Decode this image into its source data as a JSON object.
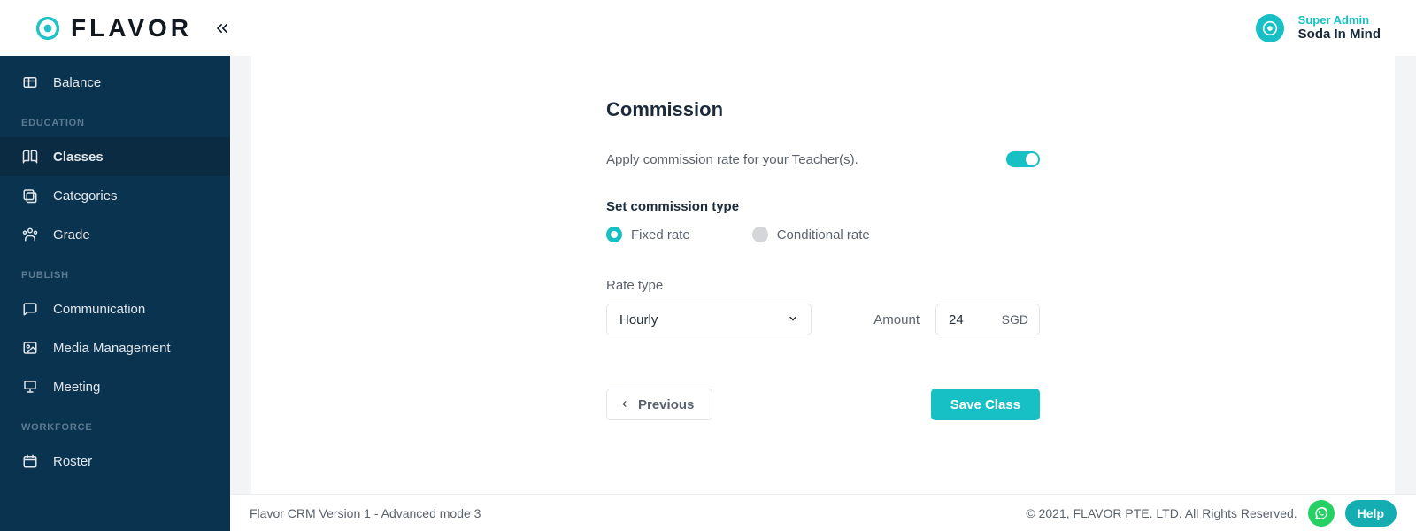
{
  "brand": {
    "name": "FLAVOR"
  },
  "topbar": {
    "user_role": "Super Admin",
    "user_name": "Soda In Mind"
  },
  "sidebar": {
    "item_balance": "Balance",
    "section_education": "EDUCATION",
    "item_classes": "Classes",
    "item_categories": "Categories",
    "item_grade": "Grade",
    "section_publish": "PUBLISH",
    "item_communication": "Communication",
    "item_media_management": "Media Management",
    "item_meeting": "Meeting",
    "section_workforce": "WORKFORCE",
    "item_roster": "Roster"
  },
  "commission": {
    "title": "Commission",
    "description": "Apply commission rate for your Teacher(s).",
    "toggle_on": true,
    "set_type_label": "Set commission type",
    "radio": {
      "fixed_label": "Fixed rate",
      "conditional_label": "Conditional rate",
      "selected": "fixed"
    },
    "rate_type_label": "Rate type",
    "rate_type_value": "Hourly",
    "amount_label": "Amount",
    "amount_value": "24",
    "amount_currency": "SGD",
    "previous_label": "Previous",
    "save_label": "Save Class"
  },
  "footer": {
    "version": "Flavor CRM Version 1 - Advanced mode 3",
    "copyright": "© 2021, FLAVOR PTE. LTD. All Rights Reserved.",
    "help_label": "Help"
  }
}
